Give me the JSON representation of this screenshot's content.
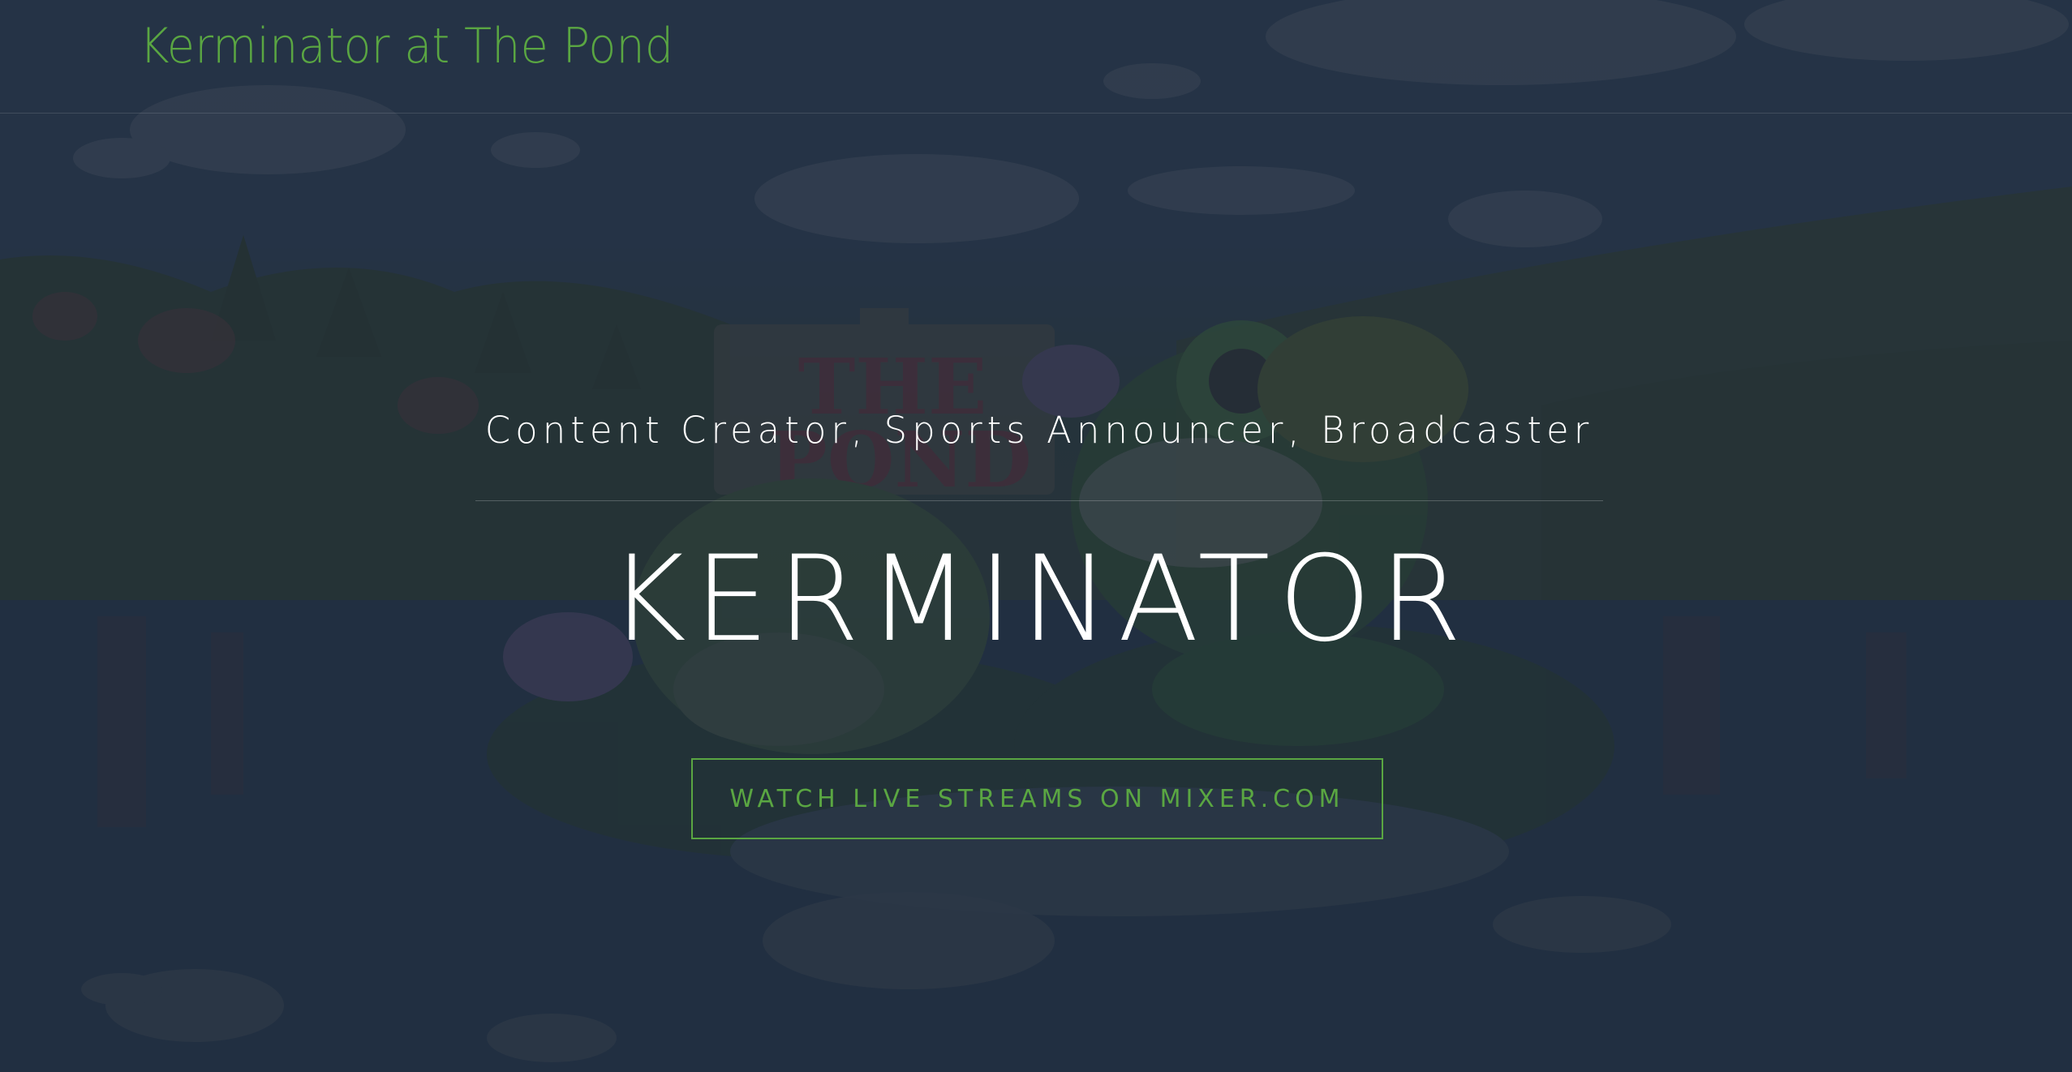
{
  "header": {
    "site_title": "Kerminator at The Pond"
  },
  "hero": {
    "tagline": "Content Creator, Sports Announcer, Broadcaster",
    "name": "KERMINATOR",
    "cta_label": "WATCH LIVE STREAMS ON MIXER.COM"
  },
  "colors": {
    "accent": "#5aa642",
    "overlay": "#202d40",
    "text": "#ffffff"
  }
}
